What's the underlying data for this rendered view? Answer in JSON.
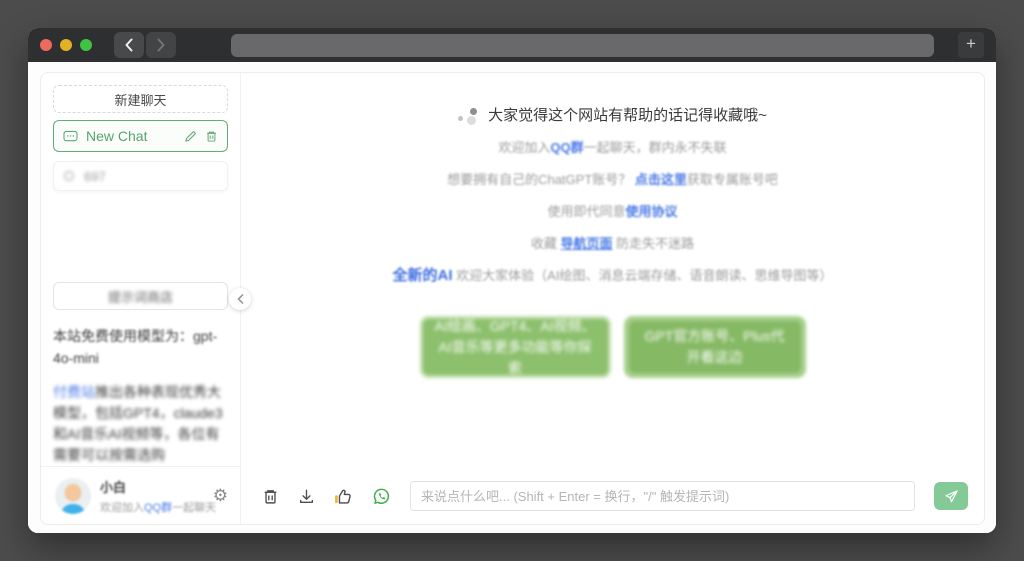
{
  "browser": {
    "new_tab": "+",
    "url_value": ""
  },
  "sidebar": {
    "new_chat_button": "新建聊天",
    "active_chat": "New Chat",
    "blurred_chat": "697",
    "prompt_shop_button": "提示词商店",
    "free_model_notice": "本站免费使用模型为：gpt-4o-mini",
    "paid_notice": {
      "link": "付费站",
      "text": "推出各种表现优秀大模型，包括GPT4，claude3和AI音乐AI视频等，各位有需要可以按需选购"
    },
    "profile": {
      "name": "小白",
      "welcome_prefix": "欢迎加入",
      "welcome_link": "QQ群",
      "welcome_suffix": "一起聊天"
    }
  },
  "main": {
    "line1": "大家觉得这个网站有帮助的话记得收藏哦~",
    "line2": {
      "prefix": "欢迎加入",
      "link": "QQ群",
      "suffix": "一起聊天，群内永不失联"
    },
    "line3": {
      "prefix": "想要拥有自己的ChatGPT账号？ ",
      "link": "点击这里",
      "suffix": "获取专属账号吧"
    },
    "line4": {
      "prefix": "使用即代同意",
      "link": "使用协议",
      "suffix": ""
    },
    "line5": {
      "prefix": "收藏 ",
      "link": "导航页面",
      "suffix": " 防走失不迷路"
    },
    "line6": {
      "lead": "全新的AI",
      "rest": " 欢迎大家体验（AI绘图、消息云端存储、语音朗读、思维导图等）"
    },
    "promo_left": "AI绘画、GPT4、AI视频、AI音乐等更多功能等你探索",
    "promo_right": "GPT官方账号、Plus代开看这边"
  },
  "composer": {
    "placeholder": "来说点什么吧... (Shift + Enter = 换行，\"/\" 触发提示词)"
  },
  "colors": {
    "accent_green": "#65ab76",
    "link_blue": "#4a7ae6",
    "promo_green": "#8cc06c",
    "send_green": "#83ca97"
  }
}
